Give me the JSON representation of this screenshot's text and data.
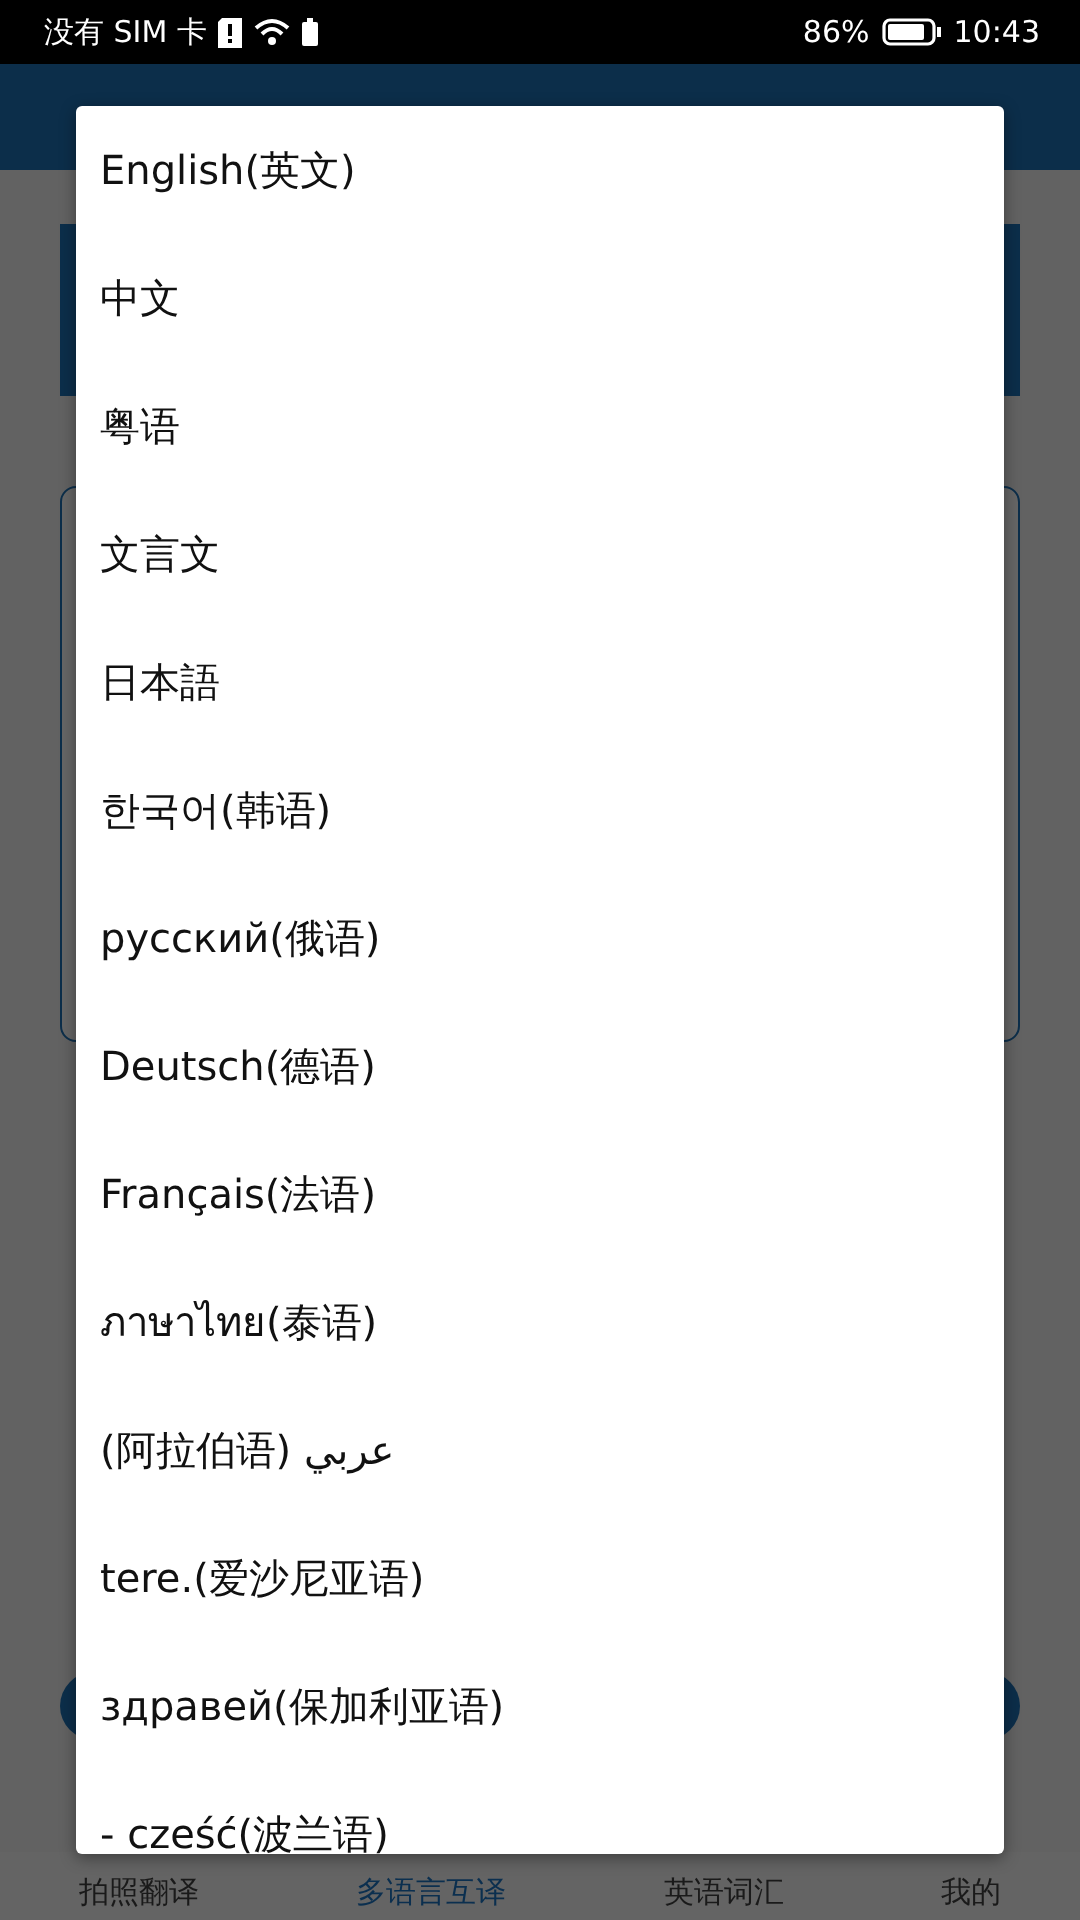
{
  "status_bar": {
    "carrier": "没有 SIM 卡",
    "battery_percent": "86%",
    "time": "10:43"
  },
  "language_dialog": {
    "items": [
      {
        "label": "English(英文)"
      },
      {
        "label": "中文"
      },
      {
        "label": "粤语"
      },
      {
        "label": "文言文"
      },
      {
        "label": "日本語"
      },
      {
        "label": "한국어(韩语)"
      },
      {
        "label": "русский(俄语)"
      },
      {
        "label": "Deutsch(德语)"
      },
      {
        "label": "Français(法语)"
      },
      {
        "label": "ภาษาไทย(泰语)"
      },
      {
        "label": "(阿拉伯语) عربي"
      },
      {
        "label": "tere.(爱沙尼亚语)"
      },
      {
        "label": "здравей(保加利亚语)"
      },
      {
        "label": "- cześć(波兰语)"
      }
    ]
  },
  "bottom_nav": [
    {
      "label": "拍照翻译",
      "selected": false
    },
    {
      "label": "多语言互译",
      "selected": true
    },
    {
      "label": "英语词汇",
      "selected": false
    },
    {
      "label": "我的",
      "selected": false
    }
  ]
}
